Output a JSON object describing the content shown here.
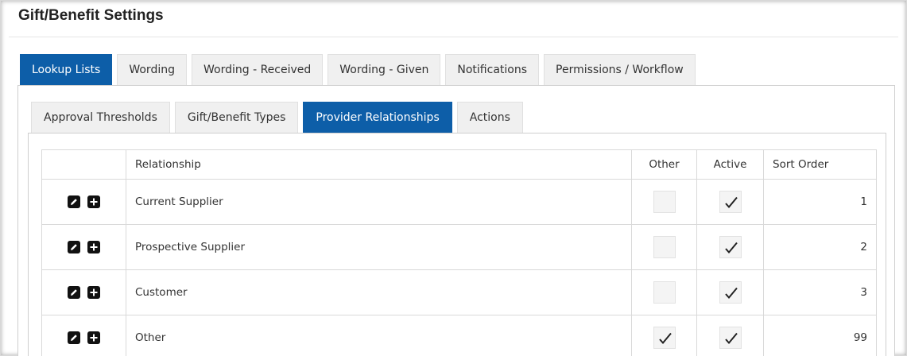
{
  "page": {
    "title": "Gift/Benefit Settings"
  },
  "main_tabs": [
    {
      "label": "Lookup Lists",
      "active": true
    },
    {
      "label": "Wording",
      "active": false
    },
    {
      "label": "Wording - Received",
      "active": false
    },
    {
      "label": "Wording - Given",
      "active": false
    },
    {
      "label": "Notifications",
      "active": false
    },
    {
      "label": "Permissions / Workflow",
      "active": false
    }
  ],
  "sub_tabs": [
    {
      "label": "Approval Thresholds",
      "active": false
    },
    {
      "label": "Gift/Benefit Types",
      "active": false
    },
    {
      "label": "Provider Relationships",
      "active": true
    },
    {
      "label": "Actions",
      "active": false
    }
  ],
  "table": {
    "headers": {
      "actions": "",
      "relationship": "Relationship",
      "other": "Other",
      "active": "Active",
      "sort_order": "Sort Order"
    },
    "rows": [
      {
        "relationship": "Current Supplier",
        "other": false,
        "active": true,
        "sort_order": "1"
      },
      {
        "relationship": "Prospective Supplier",
        "other": false,
        "active": true,
        "sort_order": "2"
      },
      {
        "relationship": "Customer",
        "other": false,
        "active": true,
        "sort_order": "3"
      },
      {
        "relationship": "Other",
        "other": true,
        "active": true,
        "sort_order": "99"
      }
    ]
  },
  "icons": {
    "edit": "edit-icon",
    "add": "add-icon",
    "check": "check-icon"
  },
  "colors": {
    "accent": "#0d5ea8",
    "tab_bg": "#f0f0f0"
  }
}
